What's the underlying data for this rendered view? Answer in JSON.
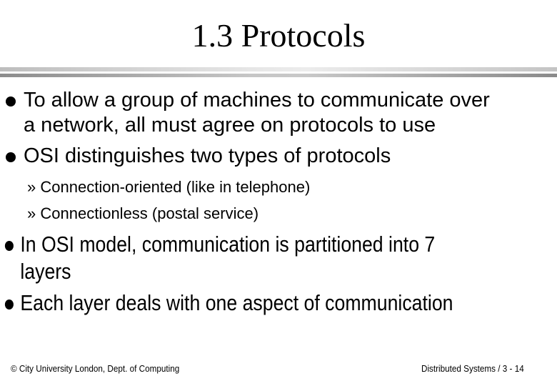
{
  "slide": {
    "title": "1.3 Protocols",
    "bullets": [
      {
        "lines": [
          "To allow a group of machines to communicate over",
          "a network, all must agree on protocols to use"
        ]
      },
      {
        "lines": [
          "OSI distinguishes two types of protocols"
        ]
      }
    ],
    "sub_bullets": [
      {
        "marker": "»",
        "text": "Connection-oriented (like in telephone)"
      },
      {
        "marker": "»",
        "text": "Connectionless (postal service)"
      }
    ],
    "bullets2": [
      {
        "lines": [
          "In OSI model, communication is partitioned into 7",
          "layers"
        ]
      },
      {
        "lines": [
          "Each layer deals with one aspect of communication"
        ]
      }
    ],
    "footer": {
      "left": "© City University London, Dept. of Computing",
      "right": "Distributed Systems / 3 - 14"
    }
  }
}
